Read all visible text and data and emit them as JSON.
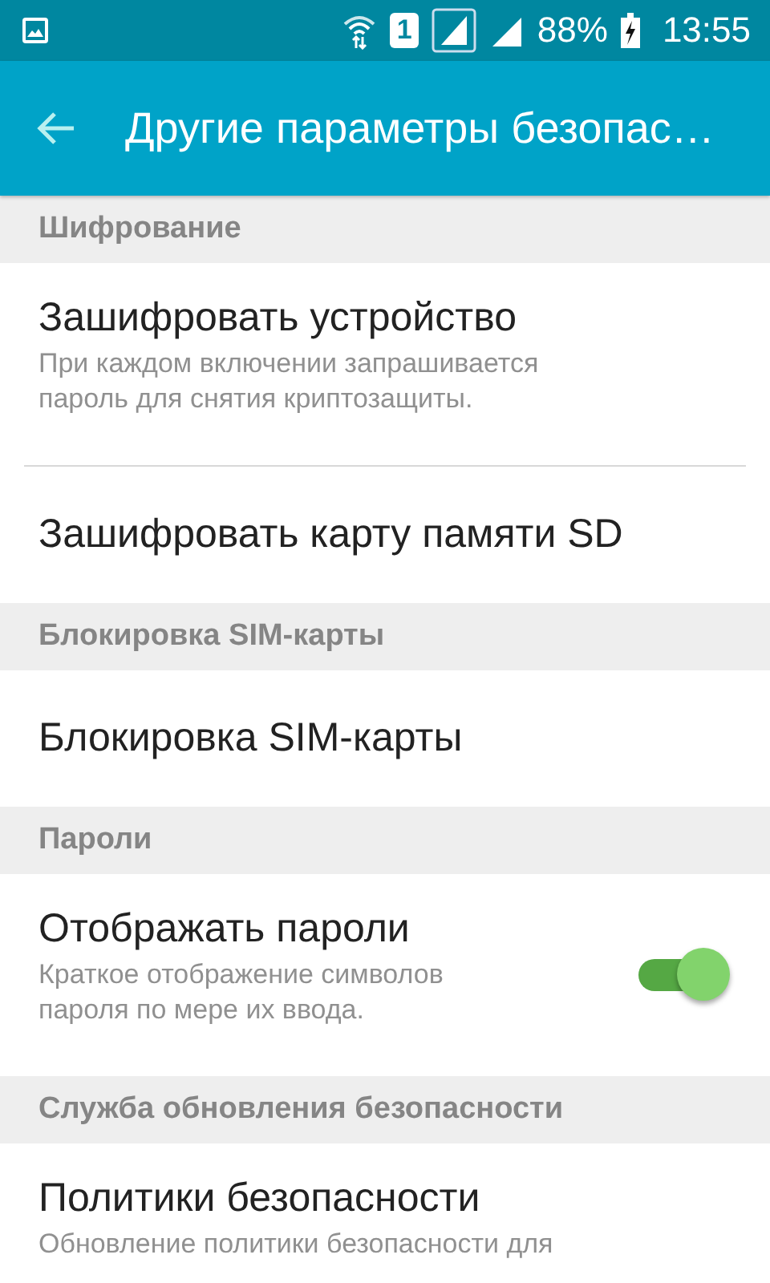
{
  "status_bar": {
    "sim_label": "1",
    "battery": "88%",
    "time": "13:55"
  },
  "app_bar": {
    "title": "Другие параметры безопас…"
  },
  "sections": [
    {
      "header": "Шифрование",
      "items": [
        {
          "kind": "plain",
          "title": "Зашифровать устройство",
          "summary": "При каждом включении запрашивается\nпароль для снятия криптозащиты."
        },
        {
          "kind": "plain",
          "title": "Зашифровать карту памяти SD"
        }
      ]
    },
    {
      "header": "Блокировка SIM-карты",
      "items": [
        {
          "kind": "plain",
          "title": "Блокировка SIM-карты"
        }
      ]
    },
    {
      "header": "Пароли",
      "items": [
        {
          "kind": "switch",
          "title": "Отображать пароли",
          "summary": "Краткое отображение символов\nпароля по мере их ввода.",
          "checked": true
        }
      ]
    },
    {
      "header": "Служба обновления безопасности",
      "items": [
        {
          "kind": "plain",
          "title": "Политики безопасности",
          "summary": "Обновление политики безопасности для"
        }
      ]
    }
  ]
}
